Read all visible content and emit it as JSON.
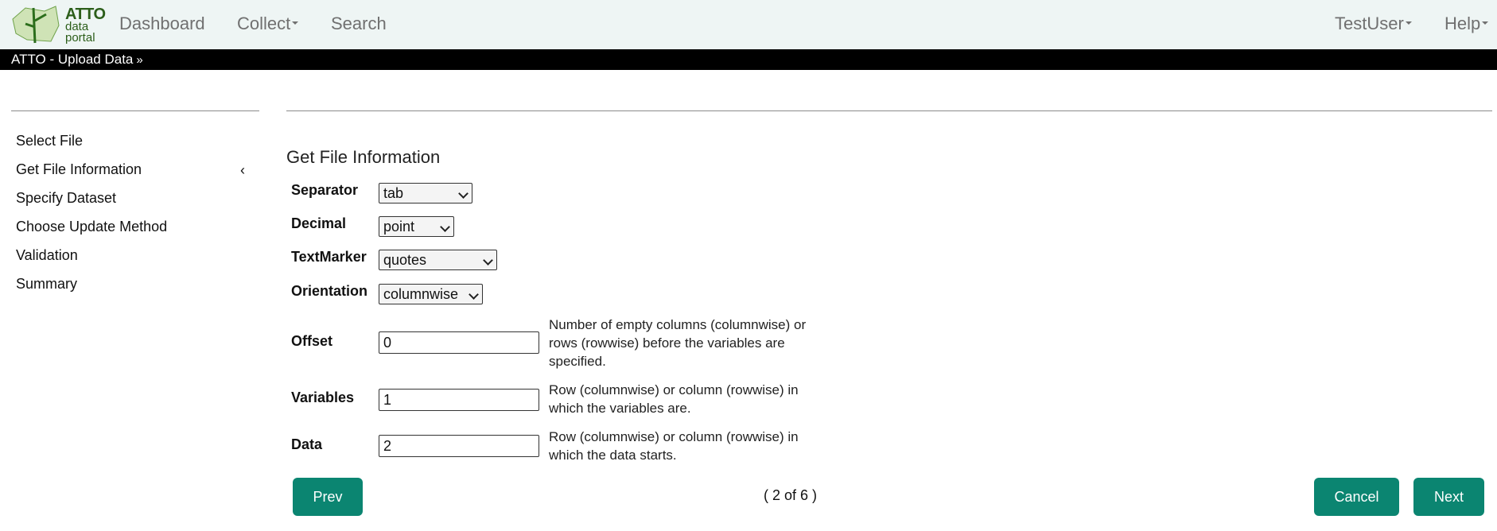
{
  "nav": {
    "logo": {
      "line1": "ATTO",
      "line2": "data",
      "line3": "portal"
    },
    "dashboard": "Dashboard",
    "collect": "Collect",
    "search": "Search",
    "user": "TestUser",
    "help": "Help"
  },
  "subbar": {
    "title": "ATTO - Upload Data",
    "icon": "chevron-double-down-icon"
  },
  "sidebar": {
    "items": [
      {
        "label": "Select File"
      },
      {
        "label": "Get File Information",
        "active": true
      },
      {
        "label": "Specify Dataset"
      },
      {
        "label": "Choose Update Method"
      },
      {
        "label": "Validation"
      },
      {
        "label": "Summary"
      }
    ],
    "active_marker": "‹"
  },
  "form": {
    "title": "Get File Information",
    "separator": {
      "label": "Separator",
      "value": "tab"
    },
    "decimal": {
      "label": "Decimal",
      "value": "point"
    },
    "textmarker": {
      "label": "TextMarker",
      "value": "quotes"
    },
    "orientation": {
      "label": "Orientation",
      "value": "columnwise"
    },
    "offset": {
      "label": "Offset",
      "value": "0",
      "help": "Number of empty columns (columnwise) or rows (rowwise) before the variables are specified."
    },
    "variables": {
      "label": "Variables",
      "value": "1",
      "help": "Row (columnwise) or column (rowwise) in which the variables are."
    },
    "data": {
      "label": "Data",
      "value": "2",
      "help": "Row (columnwise) or column (rowwise) in which the data starts."
    }
  },
  "footer": {
    "prev": "Prev",
    "pager": "( 2 of 6 )",
    "cancel": "Cancel",
    "next": "Next"
  },
  "colors": {
    "accent": "#0b8571",
    "subbar": "#000000",
    "nav_bg": "#eef5f4"
  }
}
